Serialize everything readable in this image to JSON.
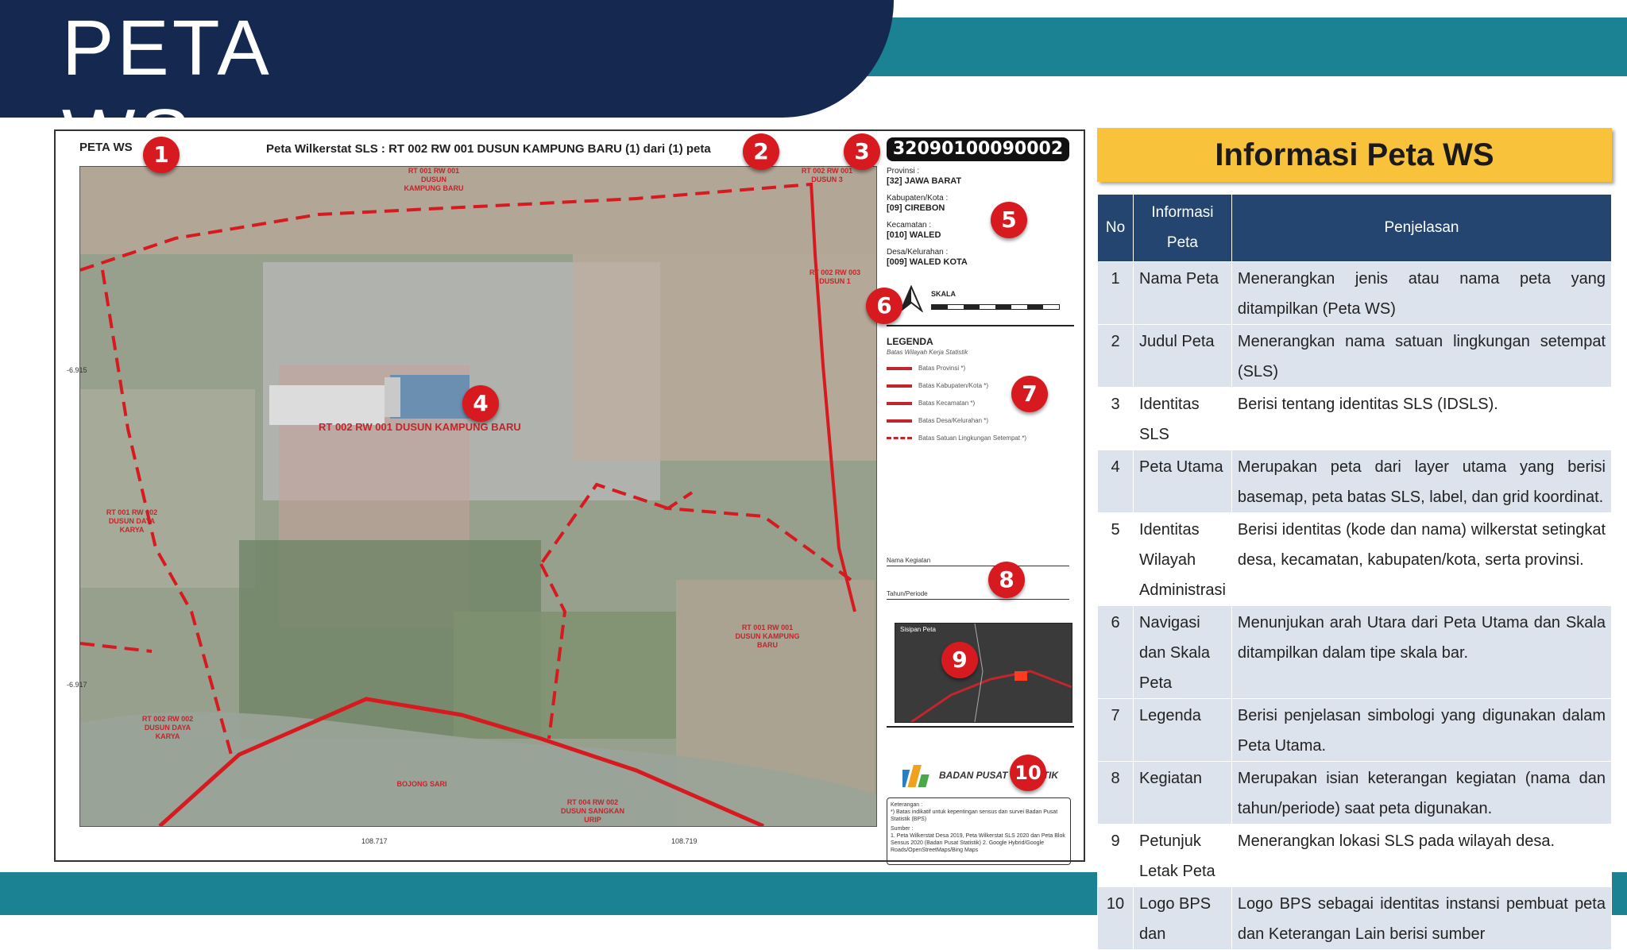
{
  "slide": {
    "title": "PETA WS"
  },
  "map": {
    "map_name": "PETA WS",
    "judul": "Peta Wilkerstat SLS : RT 002 RW 001 DUSUN KAMPUNG BARU (1) dari (1) peta",
    "idsls": "32090100090002",
    "main_label": "RT 002 RW 001 DUSUN KAMPUNG BARU",
    "area_labels": [
      "RT 001 RW 001 DUSUN KAMPUNG BARU",
      "RT 002 RW 001 DUSUN 3",
      "RT 002 RW 003 DUSUN 1",
      "RT 001 RW 002 DUSUN DAYA KARYA",
      "RT 001 RW 001 DUSUN KAMPUNG BARU",
      "RT 002 RW 002 DUSUN DAYA KARYA",
      "BOJONG SARI",
      "RT 004 RW 002 DUSUN SANGKAN URIP"
    ],
    "coords": [
      "108.717",
      "108.719",
      "-6.915",
      "-6.917"
    ],
    "provinsi_label": "Provinsi :",
    "provinsi": "[32] JAWA BARAT",
    "kabupaten_label": "Kabupaten/Kota :",
    "kabupaten": "[09] CIREBON",
    "kecamatan_label": "Kecamatan :",
    "kecamatan": "[010] WALED",
    "desa_label": "Desa/Kelurahan :",
    "desa": "[009] WALED KOTA",
    "skala_label": "SKALA",
    "legenda_title": "LEGENDA",
    "legenda_subtitle": "Batas Wilayah Kerja Statistik",
    "legend_items": [
      "Batas Provinsi *)",
      "Batas Kabupaten/Kota *)",
      "Batas Kecamatan *)",
      "Batas Desa/Kelurahan *)",
      "Batas Satuan Lingkungan Setempat *)"
    ],
    "nama_kegiatan_label": "Nama Kegiatan",
    "tahun_label": "Tahun/Periode",
    "inset_label": "Sisipan Peta",
    "bps_name": "BADAN PUSAT STATISTIK",
    "keterangan_label": "Keterangan :",
    "keterangan_text": "*) Batas indikatif untuk kepentingan sensus dan survei Badan Pusat Statistik (BPS)",
    "sumber_label": "Sumber :",
    "sumber_text": "1. Peta Wilkerstat Desa 2019, Peta Wilkerstat SLS 2020 dan Peta Blok Sensus 2020 (Badan Pusat Statistik) 2. Google Hybrid/Google Roads/OpenStreetMaps/Bing Maps",
    "markers": [
      "1",
      "2",
      "3",
      "4",
      "5",
      "6",
      "7",
      "8",
      "9",
      "10"
    ]
  },
  "info": {
    "header": "Informasi Peta WS",
    "col_no": "No",
    "col_info": "Informasi Peta",
    "col_desc": "Penjelasan",
    "rows": [
      {
        "no": "1",
        "info": "Nama Peta",
        "desc": "Menerangkan jenis atau nama peta yang ditampilkan (Peta WS)"
      },
      {
        "no": "2",
        "info": "Judul Peta",
        "desc": "Menerangkan nama satuan lingkungan setempat (SLS)"
      },
      {
        "no": "3",
        "info": "Identitas SLS",
        "desc": "Berisi tentang identitas SLS (IDSLS)."
      },
      {
        "no": "4",
        "info": "Peta Utama",
        "desc": "Merupakan peta dari layer utama yang berisi basemap, peta batas SLS, label, dan grid koordinat."
      },
      {
        "no": "5",
        "info": "Identitas Wilayah Administrasi",
        "desc": "Berisi identitas (kode dan nama) wilkerstat setingkat desa, kecamatan, kabupaten/kota, serta provinsi."
      },
      {
        "no": "6",
        "info": "Navigasi dan Skala Peta",
        "desc": "Menunjukan arah Utara dari Peta Utama dan Skala ditampilkan dalam tipe skala bar."
      },
      {
        "no": "7",
        "info": "Legenda",
        "desc": "Berisi penjelasan simbologi yang digunakan dalam Peta Utama."
      },
      {
        "no": "8",
        "info": "Kegiatan",
        "desc": "Merupakan isian keterangan kegiatan (nama dan tahun/periode) saat peta digunakan."
      },
      {
        "no": "9",
        "info": "Petunjuk Letak Peta",
        "desc": "Menerangkan lokasi SLS pada wilayah desa."
      },
      {
        "no": "10",
        "info": "Logo BPS dan",
        "desc": "Logo BPS sebagai identitas instansi pembuat peta dan Keterangan Lain berisi sumber"
      }
    ]
  },
  "colors": {
    "navy": "#15284f",
    "teal": "#1b8294",
    "gold": "#f8c33b",
    "table_header": "#24456f",
    "marker_red": "#d71920"
  }
}
